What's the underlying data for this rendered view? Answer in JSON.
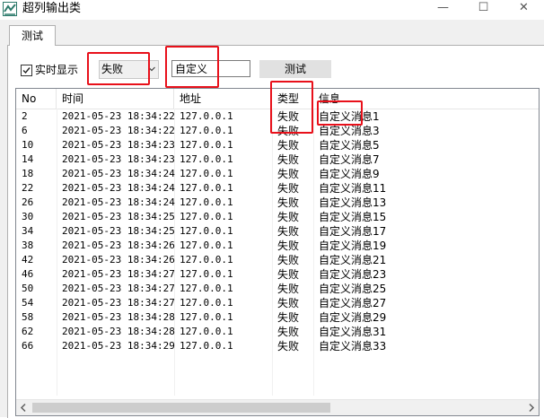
{
  "window": {
    "title": "超列输出类",
    "minimize_glyph": "—",
    "maximize_glyph": "☐",
    "close_glyph": "✕"
  },
  "tabs": [
    {
      "label": "测试",
      "active": true
    }
  ],
  "toolbar": {
    "realtime_label": "实时显示",
    "realtime_checked": true,
    "filter_value": "失败",
    "input_value": "自定义",
    "test_button_label": "测试"
  },
  "table": {
    "columns": [
      "No",
      "时间",
      "地址",
      "类型",
      "信息"
    ],
    "rows": [
      [
        "2",
        "2021-05-23 18:34:22",
        "127.0.0.1",
        "失败",
        "自定义消息1"
      ],
      [
        "6",
        "2021-05-23 18:34:22",
        "127.0.0.1",
        "失败",
        "自定义消息3"
      ],
      [
        "10",
        "2021-05-23 18:34:23",
        "127.0.0.1",
        "失败",
        "自定义消息5"
      ],
      [
        "14",
        "2021-05-23 18:34:23",
        "127.0.0.1",
        "失败",
        "自定义消息7"
      ],
      [
        "18",
        "2021-05-23 18:34:24",
        "127.0.0.1",
        "失败",
        "自定义消息9"
      ],
      [
        "22",
        "2021-05-23 18:34:24",
        "127.0.0.1",
        "失败",
        "自定义消息11"
      ],
      [
        "26",
        "2021-05-23 18:34:24",
        "127.0.0.1",
        "失败",
        "自定义消息13"
      ],
      [
        "30",
        "2021-05-23 18:34:25",
        "127.0.0.1",
        "失败",
        "自定义消息15"
      ],
      [
        "34",
        "2021-05-23 18:34:25",
        "127.0.0.1",
        "失败",
        "自定义消息17"
      ],
      [
        "38",
        "2021-05-23 18:34:26",
        "127.0.0.1",
        "失败",
        "自定义消息19"
      ],
      [
        "42",
        "2021-05-23 18:34:26",
        "127.0.0.1",
        "失败",
        "自定义消息21"
      ],
      [
        "46",
        "2021-05-23 18:34:27",
        "127.0.0.1",
        "失败",
        "自定义消息23"
      ],
      [
        "50",
        "2021-05-23 18:34:27",
        "127.0.0.1",
        "失败",
        "自定义消息25"
      ],
      [
        "54",
        "2021-05-23 18:34:27",
        "127.0.0.1",
        "失败",
        "自定义消息27"
      ],
      [
        "58",
        "2021-05-23 18:34:28",
        "127.0.0.1",
        "失败",
        "自定义消息29"
      ],
      [
        "62",
        "2021-05-23 18:34:28",
        "127.0.0.1",
        "失败",
        "自定义消息31"
      ],
      [
        "66",
        "2021-05-23 18:34:29",
        "127.0.0.1",
        "失败",
        "自定义消息33"
      ]
    ]
  },
  "colors": {
    "annotation": "#e8101a",
    "scroll_thumb": "#cdcdcd",
    "window_bg": "#f0f0f0"
  }
}
